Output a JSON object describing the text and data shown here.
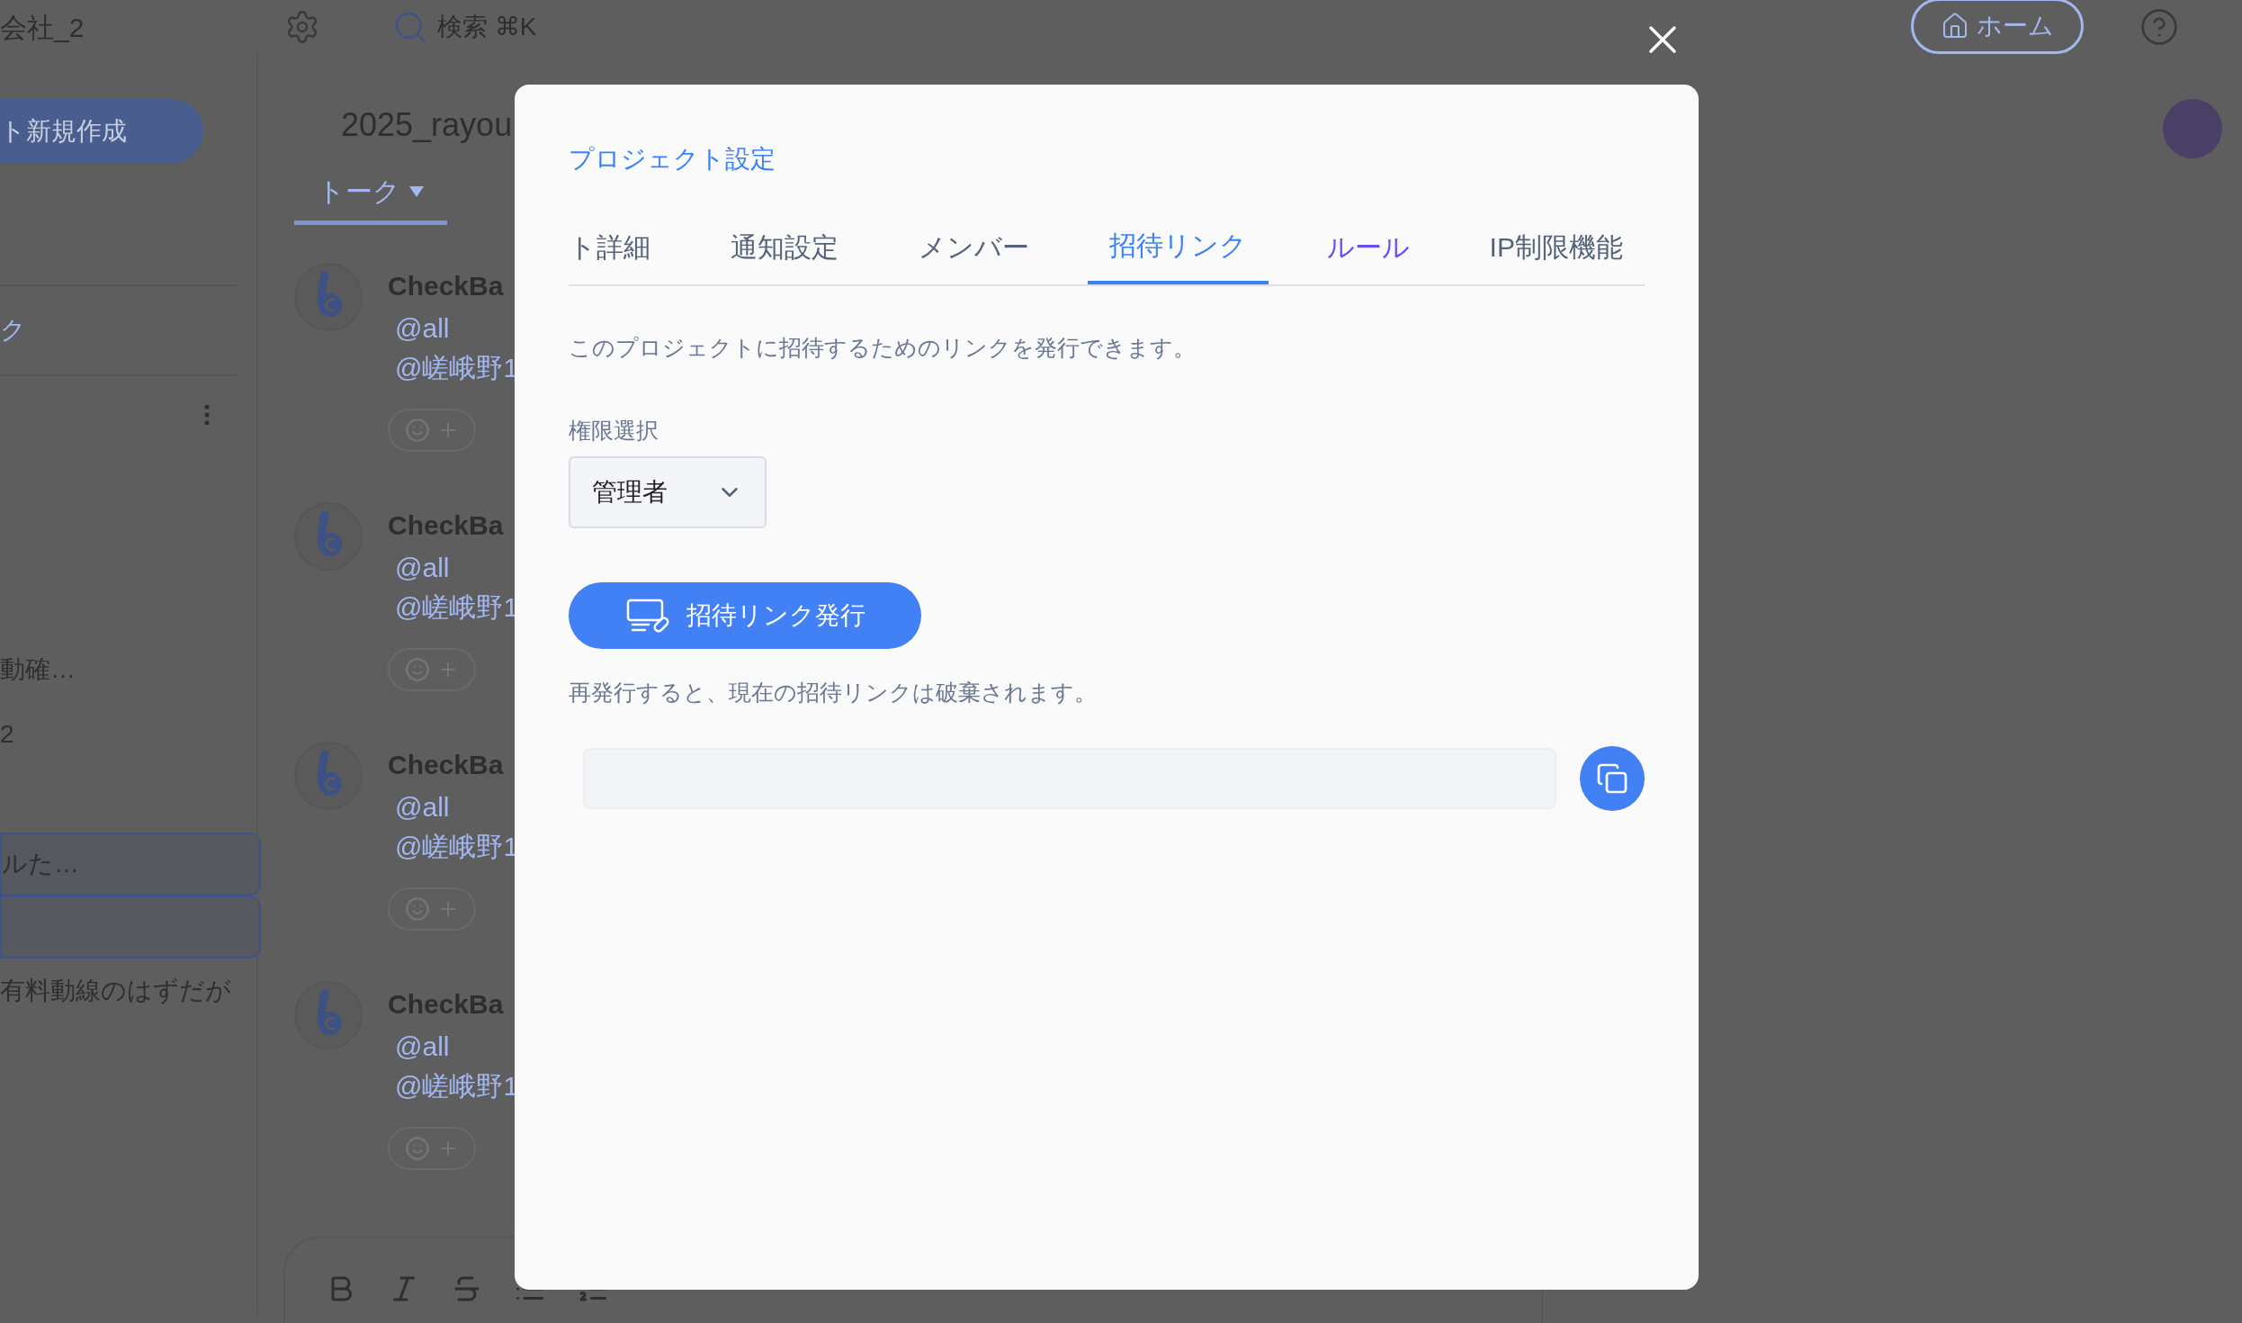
{
  "top_bar": {
    "workspace": "会社_2",
    "search": {
      "placeholder": "検索 ⌘K"
    },
    "home_button": "ホーム"
  },
  "sidebar": {
    "new_button": "ト新規作成",
    "items": [
      {
        "kind": "link",
        "label": "ク"
      },
      {
        "kind": "menu"
      },
      {
        "kind": "text",
        "label": "動確…"
      },
      {
        "kind": "text",
        "label": "2"
      },
      {
        "kind": "boxed",
        "label": "ルた…"
      },
      {
        "kind": "boxed"
      },
      {
        "kind": "text",
        "label": "有料動線のはずだが"
      }
    ]
  },
  "chat": {
    "title": "2025_rayou",
    "tab": "トーク",
    "messages": [
      {
        "sender": "CheckBa",
        "lines": [
          "@all",
          "@嵯峨野1"
        ]
      },
      {
        "sender": "CheckBa",
        "lines": [
          "@all",
          "@嵯峨野1"
        ]
      },
      {
        "sender": "CheckBa",
        "lines": [
          "@all",
          "@嵯峨野1"
        ]
      },
      {
        "sender": "CheckBa",
        "lines": [
          "@all",
          "@嵯峨野1"
        ]
      }
    ]
  },
  "modal": {
    "title": "プロジェクト設定",
    "tabs": [
      {
        "label": "ト詳細",
        "selected": false,
        "hovered": false
      },
      {
        "label": "通知設定",
        "selected": false,
        "hovered": false
      },
      {
        "label": "メンバー",
        "selected": false,
        "hovered": false
      },
      {
        "label": "招待リンク",
        "selected": true,
        "hovered": false
      },
      {
        "label": "ルール",
        "selected": false,
        "hovered": true
      },
      {
        "label": "IP制限機能",
        "selected": false,
        "hovered": false
      }
    ],
    "description": "このプロジェクトに招待するためのリンクを発行できます。",
    "role_label": "権限選択",
    "role_value": "管理者",
    "issue_button": "招待リンク発行",
    "note": "再発行すると、現在の招待リンクは破棄されます。"
  }
}
